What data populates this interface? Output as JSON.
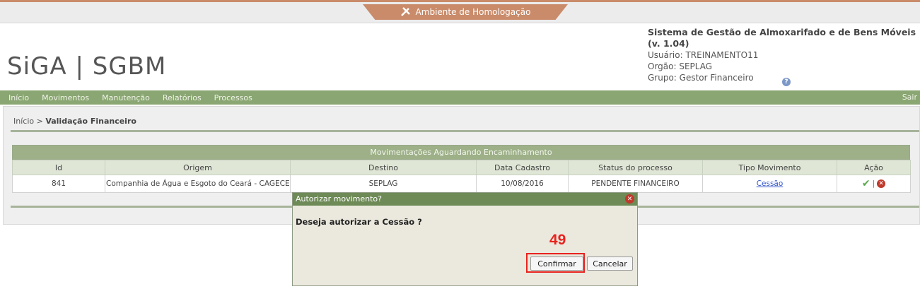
{
  "environment_banner": "Ambiente de Homologação",
  "logo": {
    "part1": "SiGA",
    "sep": "|",
    "part2": "SGBM"
  },
  "system": {
    "title": "Sistema de Gestão de Almoxarifado e de Bens Móveis (v. 1.04)",
    "user": "Usuário: TREINAMENTO11",
    "org": "Orgão: SEPLAG",
    "group": "Grupo: Gestor Financeiro"
  },
  "nav": {
    "items": [
      "Início",
      "Movimentos",
      "Manutenção",
      "Relatórios",
      "Processos"
    ],
    "logout": "Sair"
  },
  "breadcrumb": {
    "home": "Início",
    "sep": ">",
    "current": "Validação Financeiro"
  },
  "table": {
    "caption": "Movimentações Aguardando Encaminhamento",
    "headers": [
      "Id",
      "Origem",
      "Destino",
      "Data Cadastro",
      "Status do processo",
      "Tipo Movimento",
      "Ação"
    ],
    "rows": [
      {
        "id": "841",
        "origem": "Companhia de Água e Esgoto do Ceará - CAGECE",
        "destino": "SEPLAG",
        "data": "10/08/2016",
        "status": "PENDENTE FINANCEIRO",
        "tipo": "Cessão"
      }
    ]
  },
  "dialog": {
    "title": "Autorizar movimento?",
    "message": "Deseja autorizar a Cessão ?",
    "badge": "49",
    "confirm": "Confirmar",
    "cancel": "Cancelar"
  },
  "colors": {
    "nav": "#8aa672",
    "banner": "#c98b6a",
    "highlight": "#e8231f",
    "dialog_title": "#6e8a56"
  }
}
